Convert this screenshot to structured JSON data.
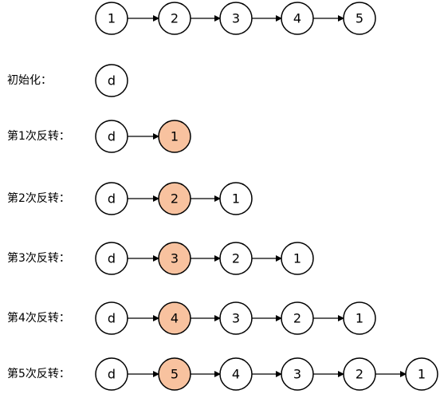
{
  "rows": [
    {
      "label": "",
      "nodes": [
        "1",
        "2",
        "3",
        "4",
        "5"
      ],
      "highlight": -1
    },
    {
      "label": "初始化：",
      "nodes": [
        "d"
      ],
      "highlight": -1
    },
    {
      "label": "第1次反转：",
      "nodes": [
        "d",
        "1"
      ],
      "highlight": 1
    },
    {
      "label": "第2次反转：",
      "nodes": [
        "d",
        "2",
        "1"
      ],
      "highlight": 1
    },
    {
      "label": "第3次反转：",
      "nodes": [
        "d",
        "3",
        "2",
        "1"
      ],
      "highlight": 1
    },
    {
      "label": "第4次反转：",
      "nodes": [
        "d",
        "4",
        "3",
        "2",
        "1"
      ],
      "highlight": 1
    },
    {
      "label": "第5次反转：",
      "nodes": [
        "d",
        "5",
        "4",
        "3",
        "2",
        "1"
      ],
      "highlight": 1
    }
  ],
  "colors": {
    "highlight_fill": "#f8c29f",
    "node_fill": "#ffffff",
    "stroke": "#000000"
  }
}
